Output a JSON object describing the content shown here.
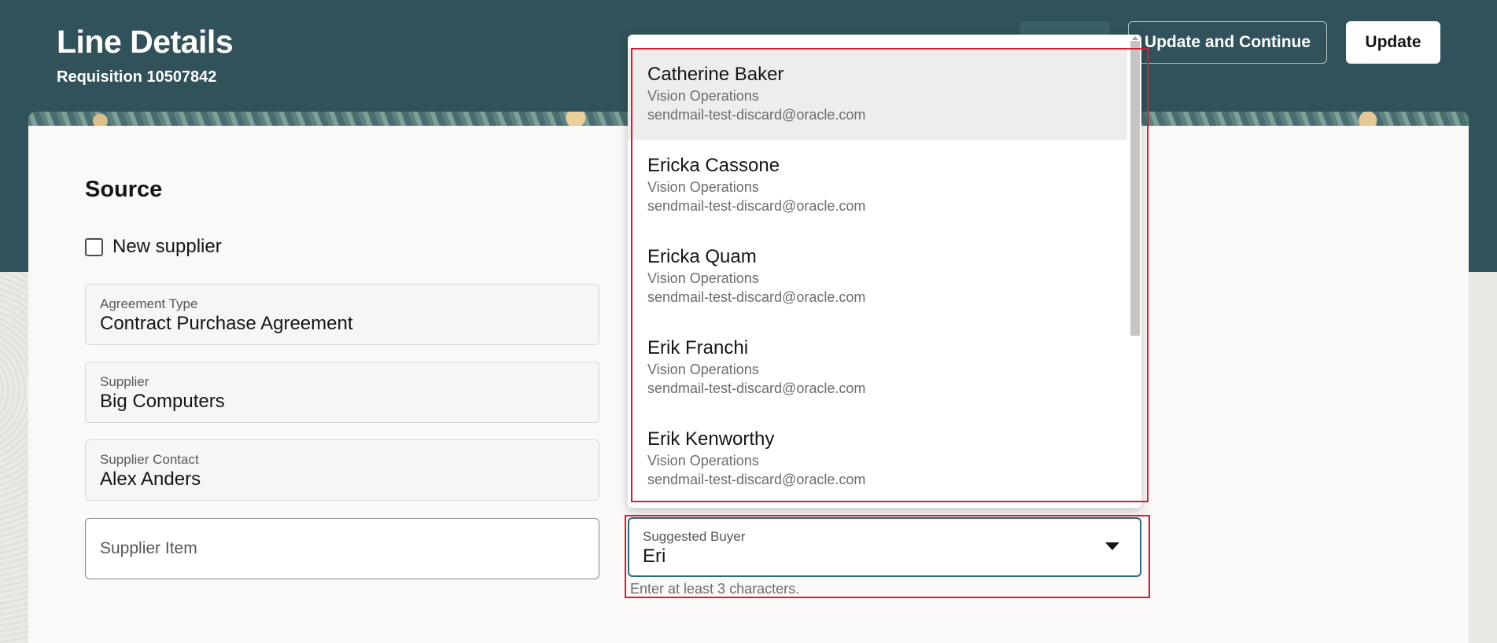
{
  "header": {
    "title": "Line Details",
    "subtitle": "Requisition 10507842",
    "update_continue_label": "Update and Continue",
    "update_label": "Update"
  },
  "source": {
    "section_title": "Source",
    "new_supplier_label": "New supplier",
    "new_supplier_checked": false,
    "agreement_type": {
      "label": "Agreement Type",
      "value": "Contract Purchase Agreement"
    },
    "supplier": {
      "label": "Supplier",
      "value": "Big Computers"
    },
    "supplier_contact": {
      "label": "Supplier Contact",
      "value": "Alex Anders"
    },
    "supplier_item": {
      "placeholder": "Supplier Item"
    }
  },
  "suggested_buyer": {
    "label": "Suggested Buyer",
    "value": "Eri",
    "helper": "Enter at least 3 characters.",
    "options": [
      {
        "name": "Catherine Baker",
        "org": "Vision Operations",
        "email": "sendmail-test-discard@oracle.com"
      },
      {
        "name": "Ericka Cassone",
        "org": "Vision Operations",
        "email": "sendmail-test-discard@oracle.com"
      },
      {
        "name": "Ericka Quam",
        "org": "Vision Operations",
        "email": "sendmail-test-discard@oracle.com"
      },
      {
        "name": "Erik Franchi",
        "org": "Vision Operations",
        "email": "sendmail-test-discard@oracle.com"
      },
      {
        "name": "Erik Kenworthy",
        "org": "Vision Operations",
        "email": "sendmail-test-discard@oracle.com"
      }
    ]
  },
  "colors": {
    "header_bg": "#31525a",
    "focus_border": "#2b6a7c",
    "highlight_box": "#cc2233"
  }
}
